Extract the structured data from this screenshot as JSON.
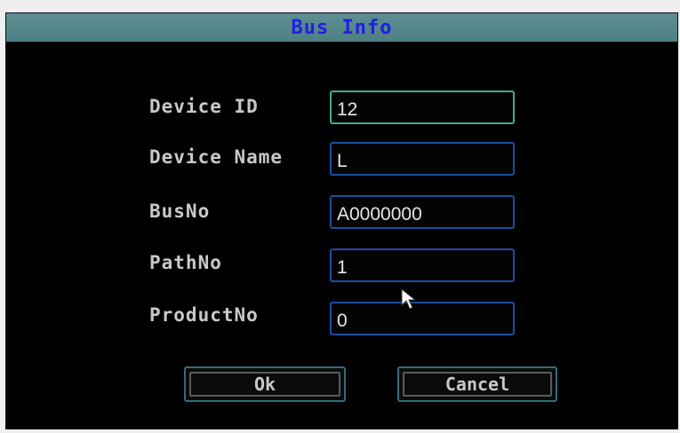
{
  "dialog": {
    "title": "Bus Info",
    "fields": [
      {
        "label": "Device ID",
        "value": "12"
      },
      {
        "label": "Device Name",
        "value": "L"
      },
      {
        "label": "BusNo",
        "value": "A0000000"
      },
      {
        "label": "PathNo",
        "value": "1"
      },
      {
        "label": "ProductNo",
        "value": "0"
      }
    ],
    "buttons": {
      "ok_label": "Ok",
      "cancel_label": "Cancel"
    }
  },
  "colors": {
    "title_bar": "#5f8f93",
    "title_text": "#1f1fe6",
    "field_border": "#1c4e9b",
    "focused_field_border": "#3fae86"
  },
  "icons": [
    "mouse-pointer-icon"
  ]
}
